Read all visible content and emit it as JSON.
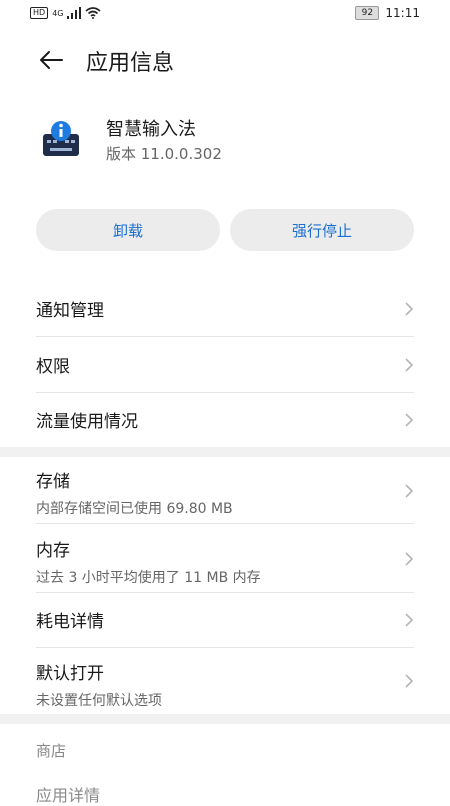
{
  "status_bar": {
    "hd": "HD",
    "network": "4G",
    "battery": "92",
    "time": "11:11"
  },
  "header": {
    "title": "应用信息"
  },
  "app": {
    "name": "智慧输入法",
    "version": "版本 11.0.0.302",
    "icon": "keyboard-info-icon"
  },
  "actions": {
    "uninstall": "卸载",
    "force_stop": "强行停止",
    "accent_color": "#1a6fd1"
  },
  "list_primary": [
    {
      "title": "通知管理"
    },
    {
      "title": "权限"
    },
    {
      "title": "流量使用情况"
    }
  ],
  "list_secondary": [
    {
      "title": "存储",
      "subtitle": "内部存储空间已使用 69.80 MB"
    },
    {
      "title": "内存",
      "subtitle": "过去 3 小时平均使用了 11 MB 内存"
    },
    {
      "title": "耗电详情"
    },
    {
      "title": "默认打开",
      "subtitle": "未设置任何默认选项"
    }
  ],
  "store": {
    "label": "商店",
    "details": "应用详情"
  }
}
